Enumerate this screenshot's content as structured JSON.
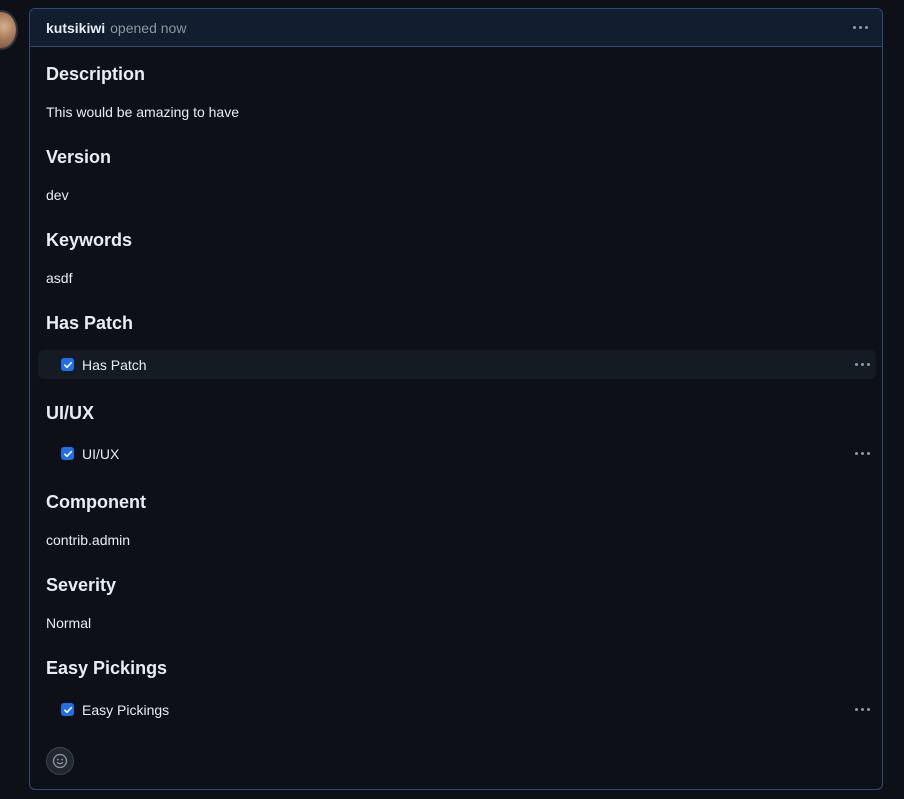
{
  "comment": {
    "author": "kutsikiwi",
    "meta": "opened now"
  },
  "sections": {
    "description": {
      "heading": "Description",
      "value": "This would be amazing to have"
    },
    "version": {
      "heading": "Version",
      "value": "dev"
    },
    "keywords": {
      "heading": "Keywords",
      "value": "asdf"
    },
    "has_patch": {
      "heading": "Has Patch",
      "task_label": "Has Patch",
      "checked": true
    },
    "uiux": {
      "heading": "UI/UX",
      "task_label": "UI/UX",
      "checked": true
    },
    "component": {
      "heading": "Component",
      "value": "contrib.admin"
    },
    "severity": {
      "heading": "Severity",
      "value": "Normal"
    },
    "easy_pickings": {
      "heading": "Easy Pickings",
      "task_label": "Easy Pickings",
      "checked": true
    }
  },
  "colors": {
    "accent": "#1f6feb",
    "border": "#2f4a78",
    "background": "#0d1117"
  }
}
